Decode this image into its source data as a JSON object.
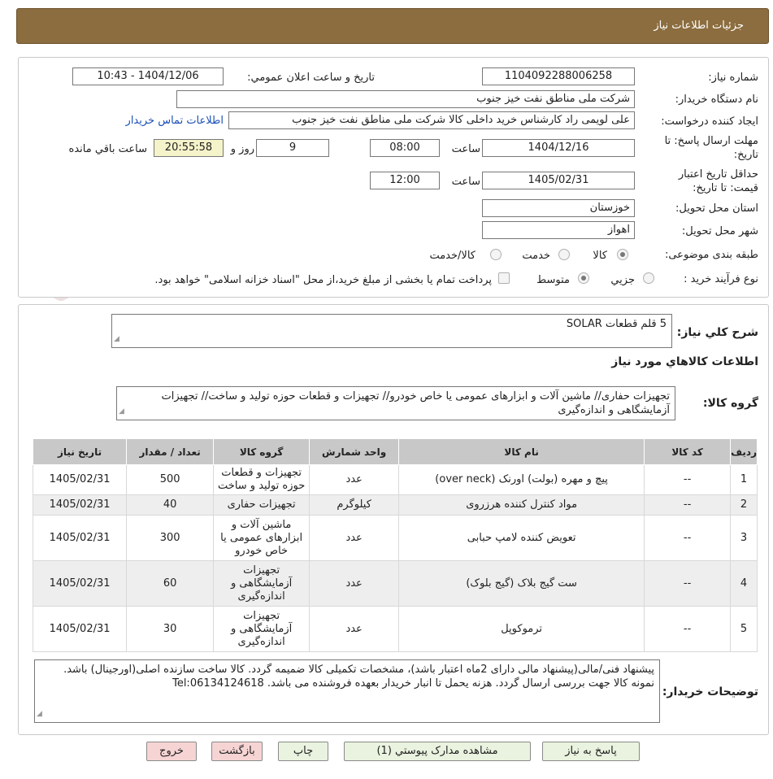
{
  "header": {
    "title": "جزئیات اطلاعات نیاز"
  },
  "info": {
    "need_number_label": "شماره نیاز:",
    "need_number": "1104092288006258",
    "announce_label": "تاریخ و ساعت اعلان عمومي:",
    "announce_value": "1404/12/06 - 10:43",
    "buyer_label": "نام دستگاه خريدار:",
    "buyer_value": "شرکت ملی مناطق نفت خیز جنوب",
    "creator_label": "ايجاد کننده درخواست:",
    "creator_value": "علی  لویمی راد  کارشناس خرید داخلی کالا شرکت ملی مناطق نفت خیز جنوب",
    "contact_link": "اطلاعات تماس خریدار",
    "deadline_label": "مهلت ارسال پاسخ: تا تاریخ:",
    "deadline_date": "1404/12/16",
    "hour_label": "ساعت",
    "deadline_time": "08:00",
    "days_value": "9",
    "days_label": "روز و",
    "remaining_time": "20:55:58",
    "remaining_label": "ساعت باقي مانده",
    "validity_label": "حداقل تاريخ اعتبار قيمت: تا تاريخ:",
    "validity_date": "1405/02/31",
    "validity_hour_label": "ساعت",
    "validity_time": "12:00",
    "province_label": "استان محل تحويل:",
    "province_value": "خوزستان",
    "city_label": "شهر محل تحويل:",
    "city_value": "اهواز",
    "category_label": "طبقه بندی موضوعی:",
    "category_options": [
      "کالا",
      "خدمت",
      "کالا/خدمت"
    ],
    "category_selected": "کالا",
    "process_label": "نوع فرآيند خريد :",
    "process_options": [
      "جزيي",
      "متوسط"
    ],
    "process_selected": "متوسط",
    "payment_note": "پرداخت تمام يا بخشی از مبلغ خريد،از محل \"اسناد خزانه اسلامی\" خواهد بود."
  },
  "watermark": {
    "text": "AriaTender.neT"
  },
  "details": {
    "summary_label": "شرح کلي نياز:",
    "summary_value": "5 قلم قطعات SOLAR",
    "goods_info_title": "اطلاعات کالاهاي مورد نياز",
    "goods_group_label": "گروه کالا:",
    "goods_group_value": "تجهیزات حفاری//  ماشین آلات و ابزارهای عمومی یا خاص خودرو// تجهیزات و قطعات حوزه تولید و ساخت// تجهیزات آزمایشگاهی و اندازه‌گیری",
    "columns": [
      "رديف",
      "کد کالا",
      "نام کالا",
      "واحد شمارش",
      "گروه کالا",
      "تعداد / مقدار",
      "تاريخ نياز"
    ],
    "rows": [
      {
        "idx": "1",
        "code": "--",
        "name": "پیچ و مهره (بولت) اورنک (over neck)",
        "unit": "عدد",
        "group": "تجهیزات و قطعات حوزه تولید و ساخت",
        "qty": "500",
        "date": "1405/02/31"
      },
      {
        "idx": "2",
        "code": "--",
        "name": "مواد کنترل کننده هرزروی",
        "unit": "کیلوگرم",
        "group": "تجهیزات حفاری",
        "qty": "40",
        "date": "1405/02/31"
      },
      {
        "idx": "3",
        "code": "--",
        "name": "تعویض کننده لامپ حبابی",
        "unit": "عدد",
        "group": "ماشین آلات و ابزارهای عمومی یا خاص خودرو",
        "qty": "300",
        "date": "1405/02/31"
      },
      {
        "idx": "4",
        "code": "--",
        "name": "ست گیج بلاک (گیج بلوک)",
        "unit": "عدد",
        "group": "تجهیزات آزمایشگاهی و اندازه‌گیری",
        "qty": "60",
        "date": "1405/02/31"
      },
      {
        "idx": "5",
        "code": "--",
        "name": "ترموکوپل",
        "unit": "عدد",
        "group": "تجهیزات آزمایشگاهی و اندازه‌گیری",
        "qty": "30",
        "date": "1405/02/31"
      }
    ],
    "buyer_notes_label": "توضيحات خريدار:",
    "buyer_notes_value": "پیشنهاد فنی/مالی(پیشنهاد مالی دارای 2ماه اعتبار باشد)، مشخصات تکمیلی کالا ضمیمه گردد. کالا ساخت سازنده اصلی(اورجینال) باشد. نمونه کالا جهت بررسی ارسال گردد. هزنه یحمل تا انبار خریدار بعهده فروشنده می باشد. Tel:06134124618"
  },
  "buttons": {
    "reply": "پاسخ به نياز",
    "attachments": "مشاهده مدارک پيوستي (1)",
    "print": "چاپ",
    "back": "بازگشت",
    "exit": "خروج"
  }
}
